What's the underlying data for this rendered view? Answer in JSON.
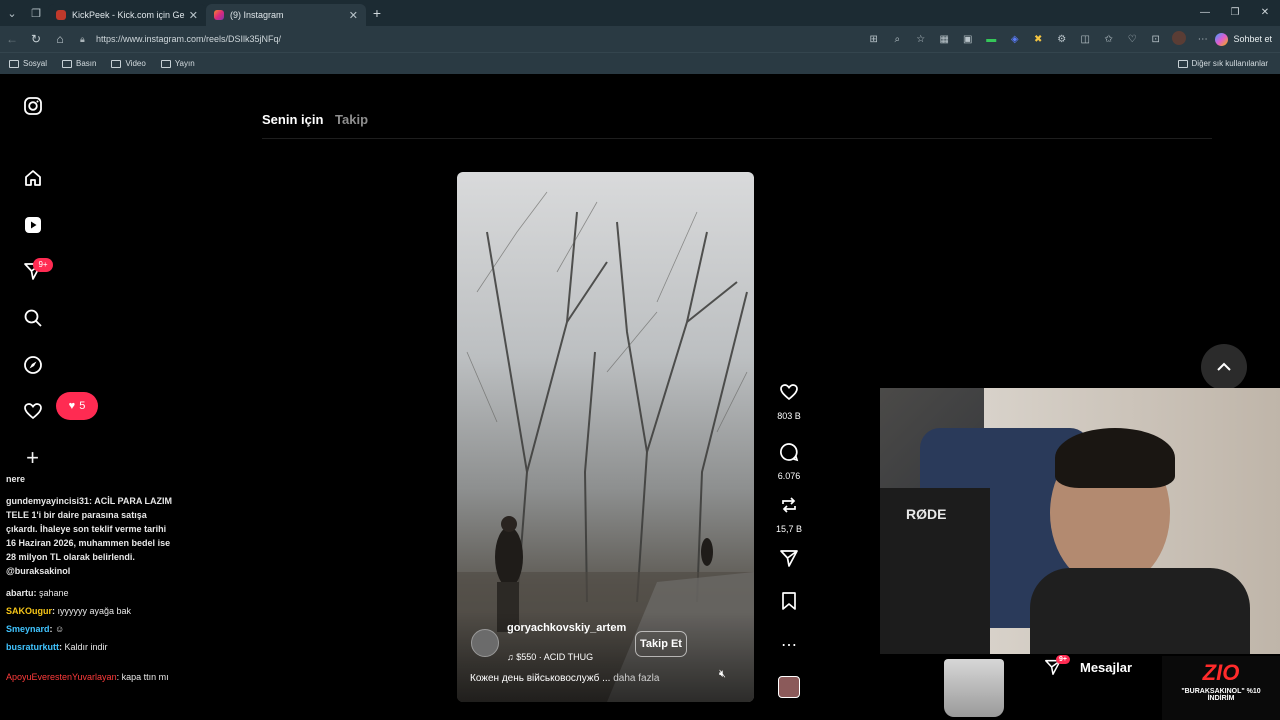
{
  "browser": {
    "tabs": [
      {
        "title": "KickPeek - Kick.com için Gerçek Za",
        "favicon_color": "#c0392b",
        "active": false
      },
      {
        "title": "(9) Instagram",
        "favicon_color": "#e1306c",
        "active": true
      }
    ],
    "url": "https://www.instagram.com/reels/DSIlk35jNFq/",
    "chat_button_label": "Sohbet et",
    "bookmarks": [
      "Sosyal",
      "Basın",
      "Video",
      "Yayın"
    ],
    "other_bookmarks_label": "Diğer sık kullanılanlar"
  },
  "feed": {
    "tabs": [
      "Senin için",
      "Takip"
    ],
    "notification_badge": "9+",
    "likes_badge": "5"
  },
  "reel": {
    "username": "goryachkovskiy_artem",
    "music": "$550 · ACID THUG",
    "follow_label": "Takip Et",
    "caption": "Кожен день військовослужб ...",
    "more_label": "daha fazla",
    "likes": "803 B",
    "comments": "6.076",
    "reposts": "15,7 B"
  },
  "messages": {
    "label": "Mesajlar",
    "badge": "9+"
  },
  "chat": {
    "header": "nere",
    "lines": [
      {
        "user": "gundemyayincisi31",
        "text": "ACİL PARA LAZIM  TELE 1'i bir daire parasına satışa çıkardı. İhaleye son teklif verme tarihi 16 Haziran 2026, muhammen bedel ise 28 milyon TL olarak belirlendi. @buraksakinol",
        "color": "#ffffff"
      },
      {
        "user": "abartu",
        "text": "şahane",
        "color": "#ffffff"
      },
      {
        "user": "SAKOugur",
        "text": "ıyyyyyy ayağa bak",
        "color": "#f5c518"
      },
      {
        "user": "Smeynard",
        "text": "",
        "color": "#40c4ff"
      },
      {
        "user": "busraturkutt",
        "text": "Kaldır indir",
        "color": "#40c4ff"
      },
      {
        "user": "ApoyuEverestenYuvarlayan",
        "text": "kapa ttın mı",
        "color": "#ff3b3b"
      }
    ]
  },
  "overlay": {
    "mic_brand": "RØDE",
    "sponsor_logo": "ZIO",
    "sponsor_text": "\"BURAKSAKINOL\" %10 İNDİRİM"
  }
}
